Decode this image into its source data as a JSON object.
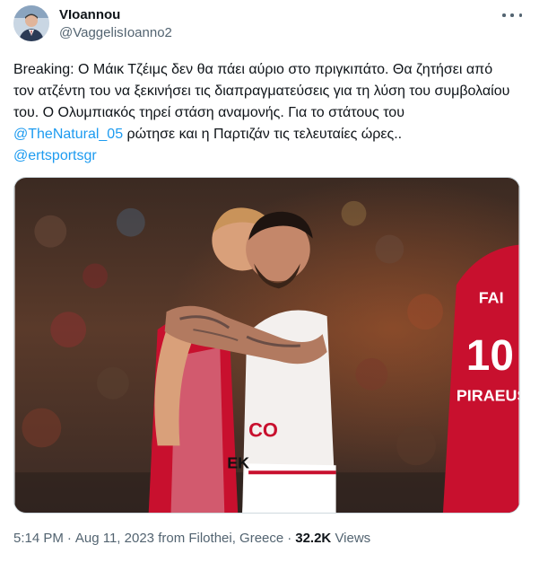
{
  "author": {
    "display_name": "VIoannou",
    "handle": "@VaggelisIoanno2"
  },
  "tweet": {
    "text_1": "Breaking: Ο Μάικ Τζέιμς δεν θα πάει αύριο στο πριγκιπάτο. Θα ζητήσει από τον ατζέντη του να ξεκινήσει τις διαπραγματεύσεις για τη λύση του συμβολαίου του. Ο Ολυμπιακός τηρεί στάση αναμονής. Για το στάτους του ",
    "mention_1": "@TheNatural_05",
    "text_2": " ρώτησε και η Παρτιζάν τις τελευταίες ώρες..",
    "mention_2": "@ertsportsgr"
  },
  "photo": {
    "jersey_number": "10",
    "jersey_text": "PIRAEUS",
    "jersey_top": "FAI"
  },
  "meta": {
    "time": "5:14 PM",
    "date": "Aug 11, 2023",
    "location": "from Filothei, Greece",
    "views_count": "32.2K",
    "views_label": "Views"
  },
  "colors": {
    "link": "#1d9bf0",
    "secondary_text": "#536471",
    "olympiacos_red": "#c8102e"
  }
}
